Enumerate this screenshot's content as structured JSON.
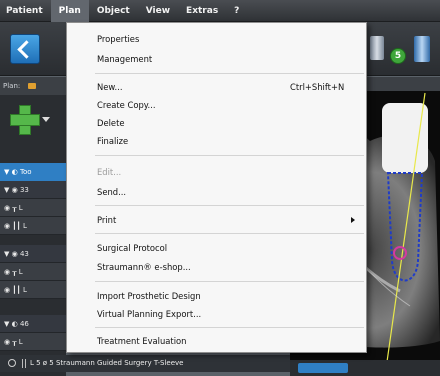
{
  "menubar": {
    "items": [
      "Patient",
      "Plan",
      "Object",
      "View",
      "Extras",
      "?"
    ]
  },
  "dropdown": {
    "items": [
      {
        "label": "Properties"
      },
      {
        "label": "Management"
      },
      {
        "label": "New...",
        "shortcut": "Ctrl+Shift+N"
      },
      {
        "label": "Create Copy..."
      },
      {
        "label": "Delete"
      },
      {
        "label": "Finalize"
      },
      {
        "label": "Edit..."
      },
      {
        "label": "Send..."
      },
      {
        "label": "Print"
      },
      {
        "label": "Surgical Protocol"
      },
      {
        "label": "Straumann® e-shop..."
      },
      {
        "label": "Import Prosthetic Design"
      },
      {
        "label": "Virtual Planning Export..."
      },
      {
        "label": "Treatment Evaluation"
      }
    ]
  },
  "toolbar": {
    "step_badge": "5"
  },
  "left_panel": {
    "plan_label": "Plan:",
    "tree_header": "▼ ◐ Too",
    "rows": [
      "▼ ◉ 33",
      "◉ ┰ L",
      "◉ ┃┃ L",
      "▼ ◉ 43",
      "◉ ┰ L",
      "◉ ┃┃ L",
      "▼ ◐ 46",
      "◉ ┰ L"
    ]
  },
  "bottom_row": {
    "text": "L 5  ø 5   Straumann Guided Surgery T-Sleeve"
  },
  "colors": {
    "menubar": "#2f3236",
    "menu_active": "#62676e",
    "highlight_blue": "#2f7fc4",
    "dropdown_bg": "#f7f7f7",
    "disabled_text": "#9c9c9c",
    "implant_outline": "#1f3cc8",
    "axis_line": "#e8e84a"
  }
}
